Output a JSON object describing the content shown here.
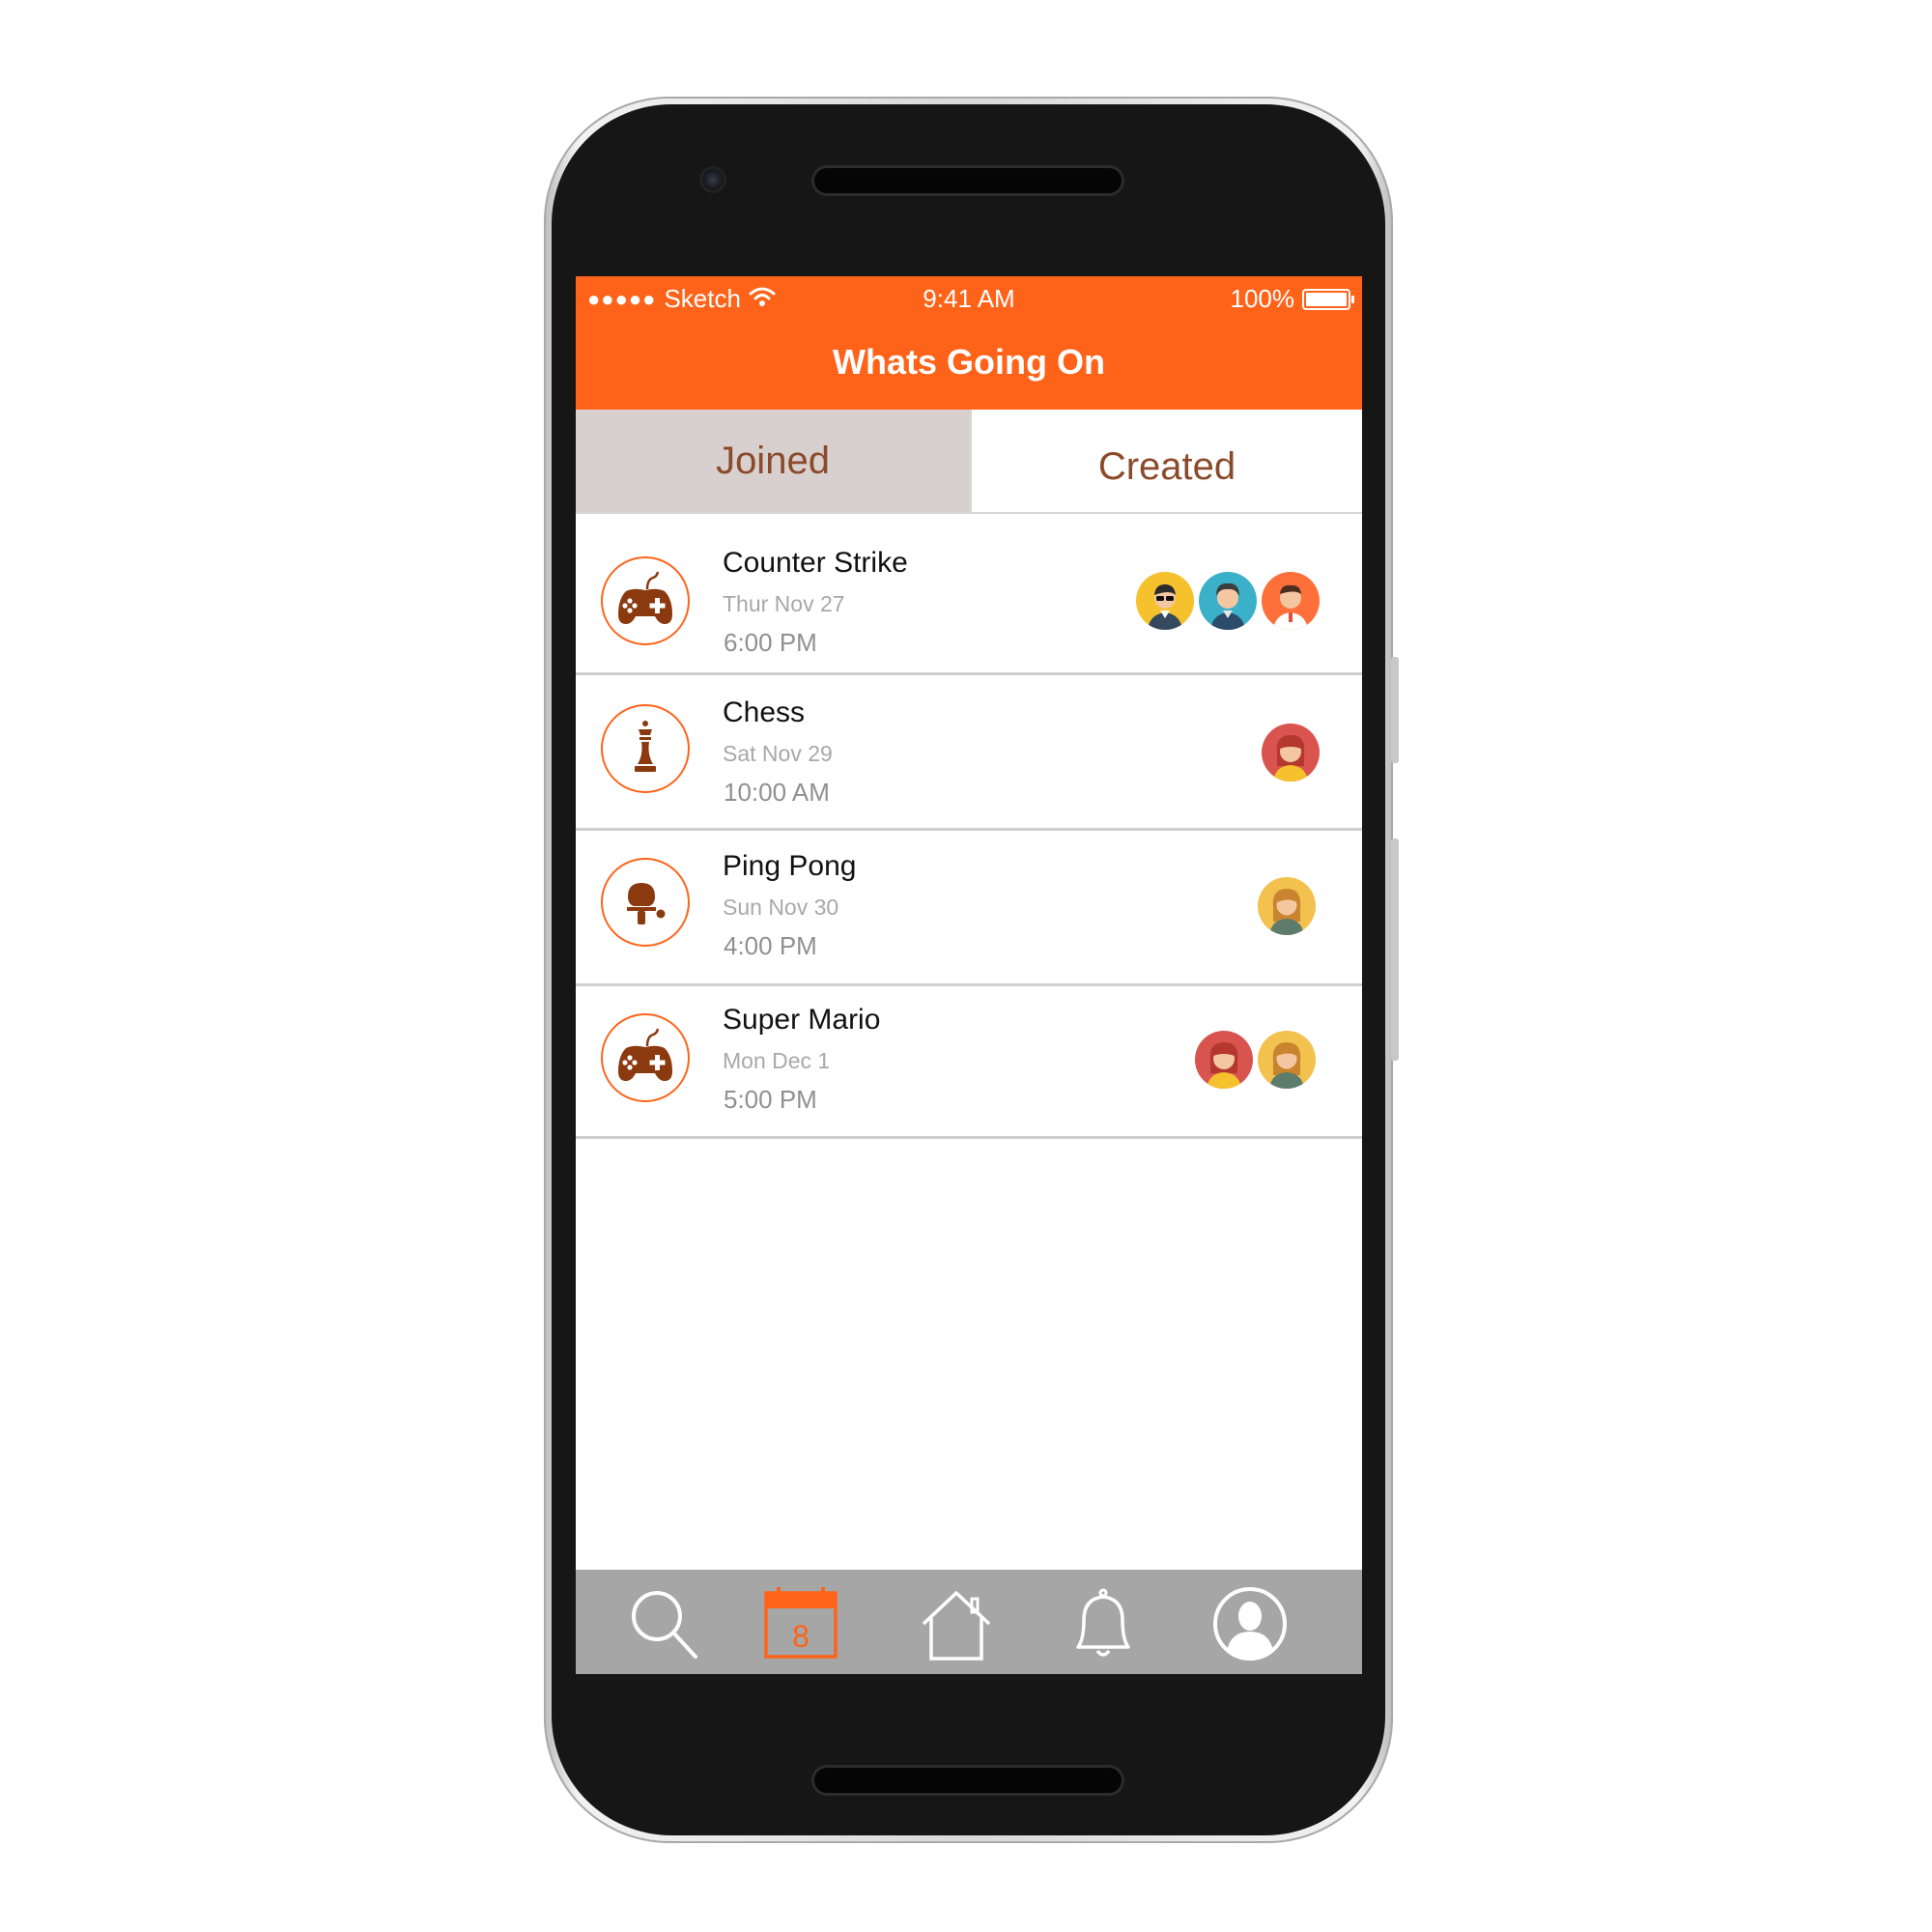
{
  "status_bar": {
    "signal": "●●●●●",
    "carrier": "Sketch",
    "time": "9:41 AM",
    "battery": "100%"
  },
  "header": {
    "title": "Whats Going On"
  },
  "tabs": [
    {
      "label": "Joined",
      "selected": true
    },
    {
      "label": "Created",
      "selected": false
    }
  ],
  "events": [
    {
      "title": "Counter Strike",
      "date": "Thur  Nov 27",
      "time": "6:00 PM",
      "icon": "gamepad-icon",
      "participants": [
        "avatar-sunglasses-man",
        "avatar-blue-man",
        "avatar-orange-man"
      ]
    },
    {
      "title": "Chess",
      "date": "Sat  Nov 29",
      "time": "10:00 AM",
      "icon": "chess-queen-icon",
      "participants": [
        "avatar-red-woman"
      ]
    },
    {
      "title": "Ping Pong",
      "date": "Sun  Nov 30",
      "time": "4:00 PM",
      "icon": "ping-pong-icon",
      "participants": [
        "avatar-yellow-woman"
      ]
    },
    {
      "title": "Super Mario",
      "date": "Mon  Dec 1",
      "time": "5:00 PM",
      "icon": "gamepad-icon",
      "participants": [
        "avatar-red-woman",
        "avatar-yellow-woman"
      ]
    }
  ],
  "bottom_nav": {
    "items": [
      "search-icon",
      "calendar-icon",
      "home-icon",
      "bell-icon",
      "profile-icon"
    ],
    "active": "calendar-icon",
    "calendar_day": "8"
  },
  "colors": {
    "accent": "#ff6319",
    "icon_brown": "#8b3a10",
    "tab_selected_bg": "#d8d0cf",
    "tab_text": "#8b4a2b",
    "bottom_bar": "#a6a6a6"
  }
}
